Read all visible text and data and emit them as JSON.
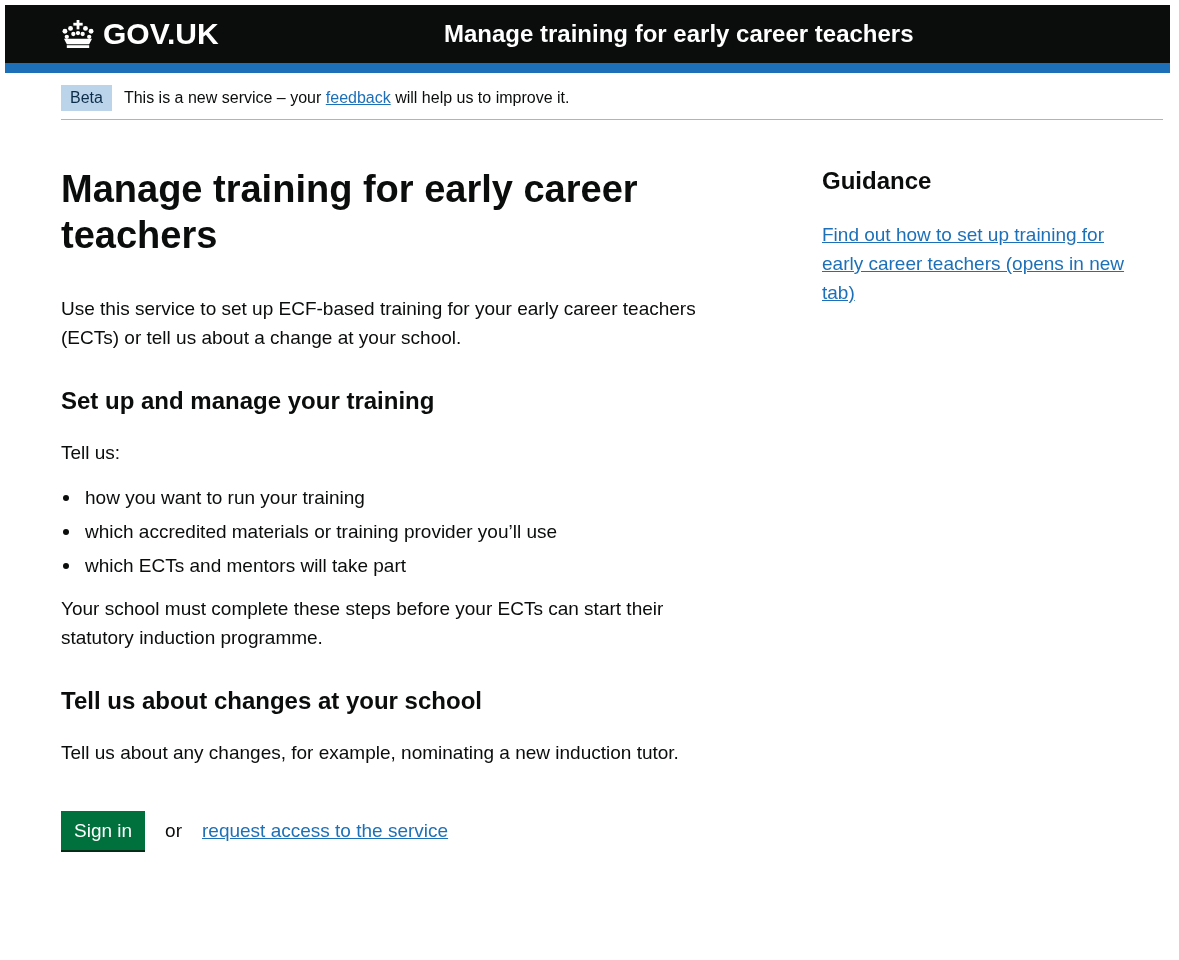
{
  "header": {
    "logo": "GOV.UK",
    "service_name": "Manage training for early career teachers"
  },
  "phase_banner": {
    "tag": "Beta",
    "text_before": "This is a new service – your",
    "link": "feedback",
    "text_after": "will help us to improve it."
  },
  "main": {
    "title": "Manage training for early career teachers",
    "intro": "Use this service to set up ECF-based training for your early career teachers (ECTs) or tell us about a change at your school.",
    "sections": [
      {
        "heading": "Set up and manage your training",
        "lead": "Tell us:",
        "bullets": [
          "how you want to run your training",
          "which accredited materials or training provider you’ll use",
          "which ECTs and mentors will take part"
        ],
        "after": "Your school must complete these steps before your ECTs can start their statutory induction programme."
      },
      {
        "heading": "Tell us about changes at your school",
        "lead": "Tell us about any changes, for example, nominating a new induction tutor."
      }
    ],
    "actions": {
      "button": "Sign in",
      "or": "or",
      "link": "request access to the service"
    }
  },
  "sidebar": {
    "heading": "Guidance",
    "link": "Find out how to set up training for early career teachers (opens in new tab)"
  }
}
